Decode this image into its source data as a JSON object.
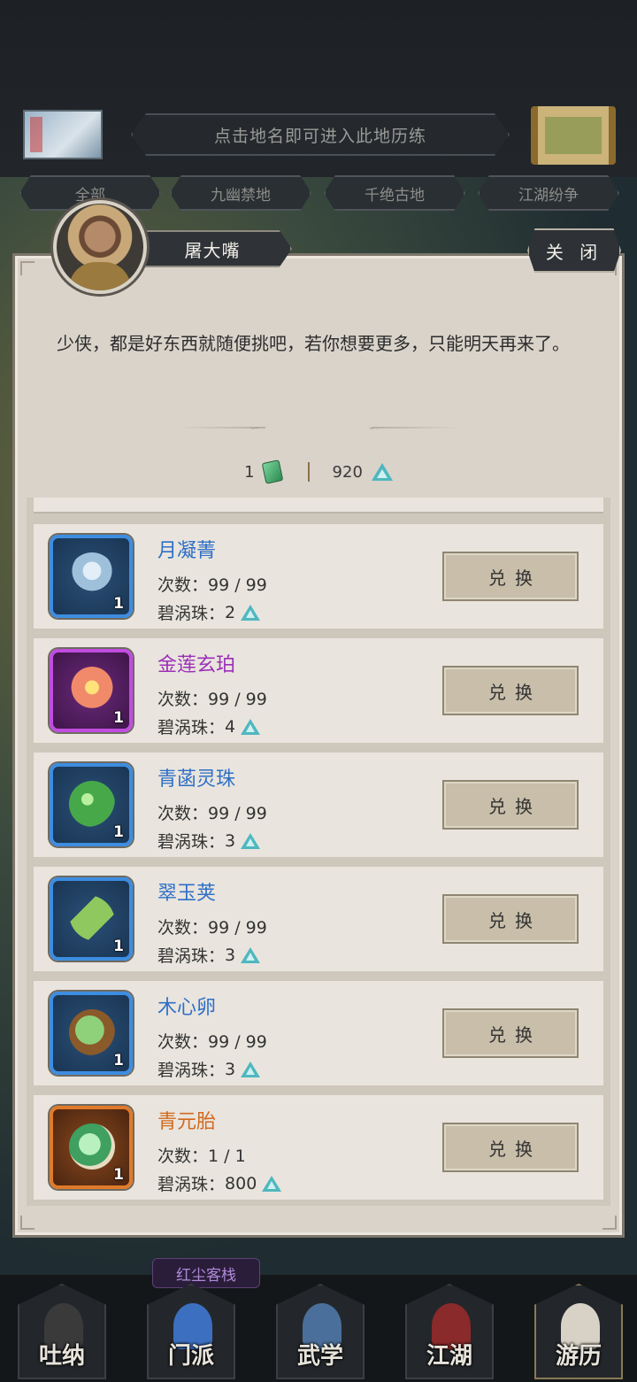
{
  "header": {
    "hint": "点击地名即可进入此地历练",
    "tabs": [
      "全部",
      "九幽禁地",
      "千绝古地",
      "江湖纷争"
    ]
  },
  "dialog": {
    "npc_name": "屠大嘴",
    "close_label": "关 闭",
    "message": "少侠，都是好东西就随便挑吧，若你想要更多，只能明天再来了。",
    "currency": {
      "jade_count": "1",
      "pearl_count": "920"
    },
    "items": [
      {
        "name": "月凝菁",
        "name_color": "#2f6fc7",
        "rarity": "blue",
        "icon": "silver-leaf-herb-icon",
        "qty": "1",
        "count_label": "次数：",
        "count": "99 / 99",
        "cost_label": "碧涡珠：",
        "cost": "2",
        "button": "兑换"
      },
      {
        "name": "金莲玄珀",
        "name_color": "#9b2fb8",
        "rarity": "purple",
        "icon": "golden-lotus-icon",
        "qty": "1",
        "count_label": "次数：",
        "count": "99 / 99",
        "cost_label": "碧涡珠：",
        "cost": "4",
        "button": "兑换"
      },
      {
        "name": "青菡灵珠",
        "name_color": "#2f6fc7",
        "rarity": "blue",
        "icon": "green-orb-icon",
        "qty": "1",
        "count_label": "次数：",
        "count": "99 / 99",
        "cost_label": "碧涡珠：",
        "cost": "3",
        "button": "兑换"
      },
      {
        "name": "翠玉荚",
        "name_color": "#2f6fc7",
        "rarity": "blue",
        "icon": "green-pea-pod-icon",
        "qty": "1",
        "count_label": "次数：",
        "count": "99 / 99",
        "cost_label": "碧涡珠：",
        "cost": "3",
        "button": "兑换"
      },
      {
        "name": "木心卵",
        "name_color": "#2f6fc7",
        "rarity": "blue",
        "icon": "wood-heart-egg-icon",
        "qty": "1",
        "count_label": "次数：",
        "count": "99 / 99",
        "cost_label": "碧涡珠：",
        "cost": "3",
        "button": "兑换"
      },
      {
        "name": "青元胎",
        "name_color": "#d2691e",
        "rarity": "orange",
        "icon": "green-embryo-icon",
        "qty": "1",
        "count_label": "次数：",
        "count": "1 / 1",
        "cost_label": "碧涡珠：",
        "cost": "800",
        "button": "兑换"
      }
    ]
  },
  "bottom": {
    "location_label": "红尘客栈",
    "nav": [
      "吐纳",
      "门派",
      "武学",
      "江湖",
      "游历"
    ],
    "active": "游历"
  },
  "colors": {
    "dialog_bg": "#d9d3ca",
    "pearl_icon": "#4fb7bf",
    "button_bg": "#c8bea9"
  }
}
